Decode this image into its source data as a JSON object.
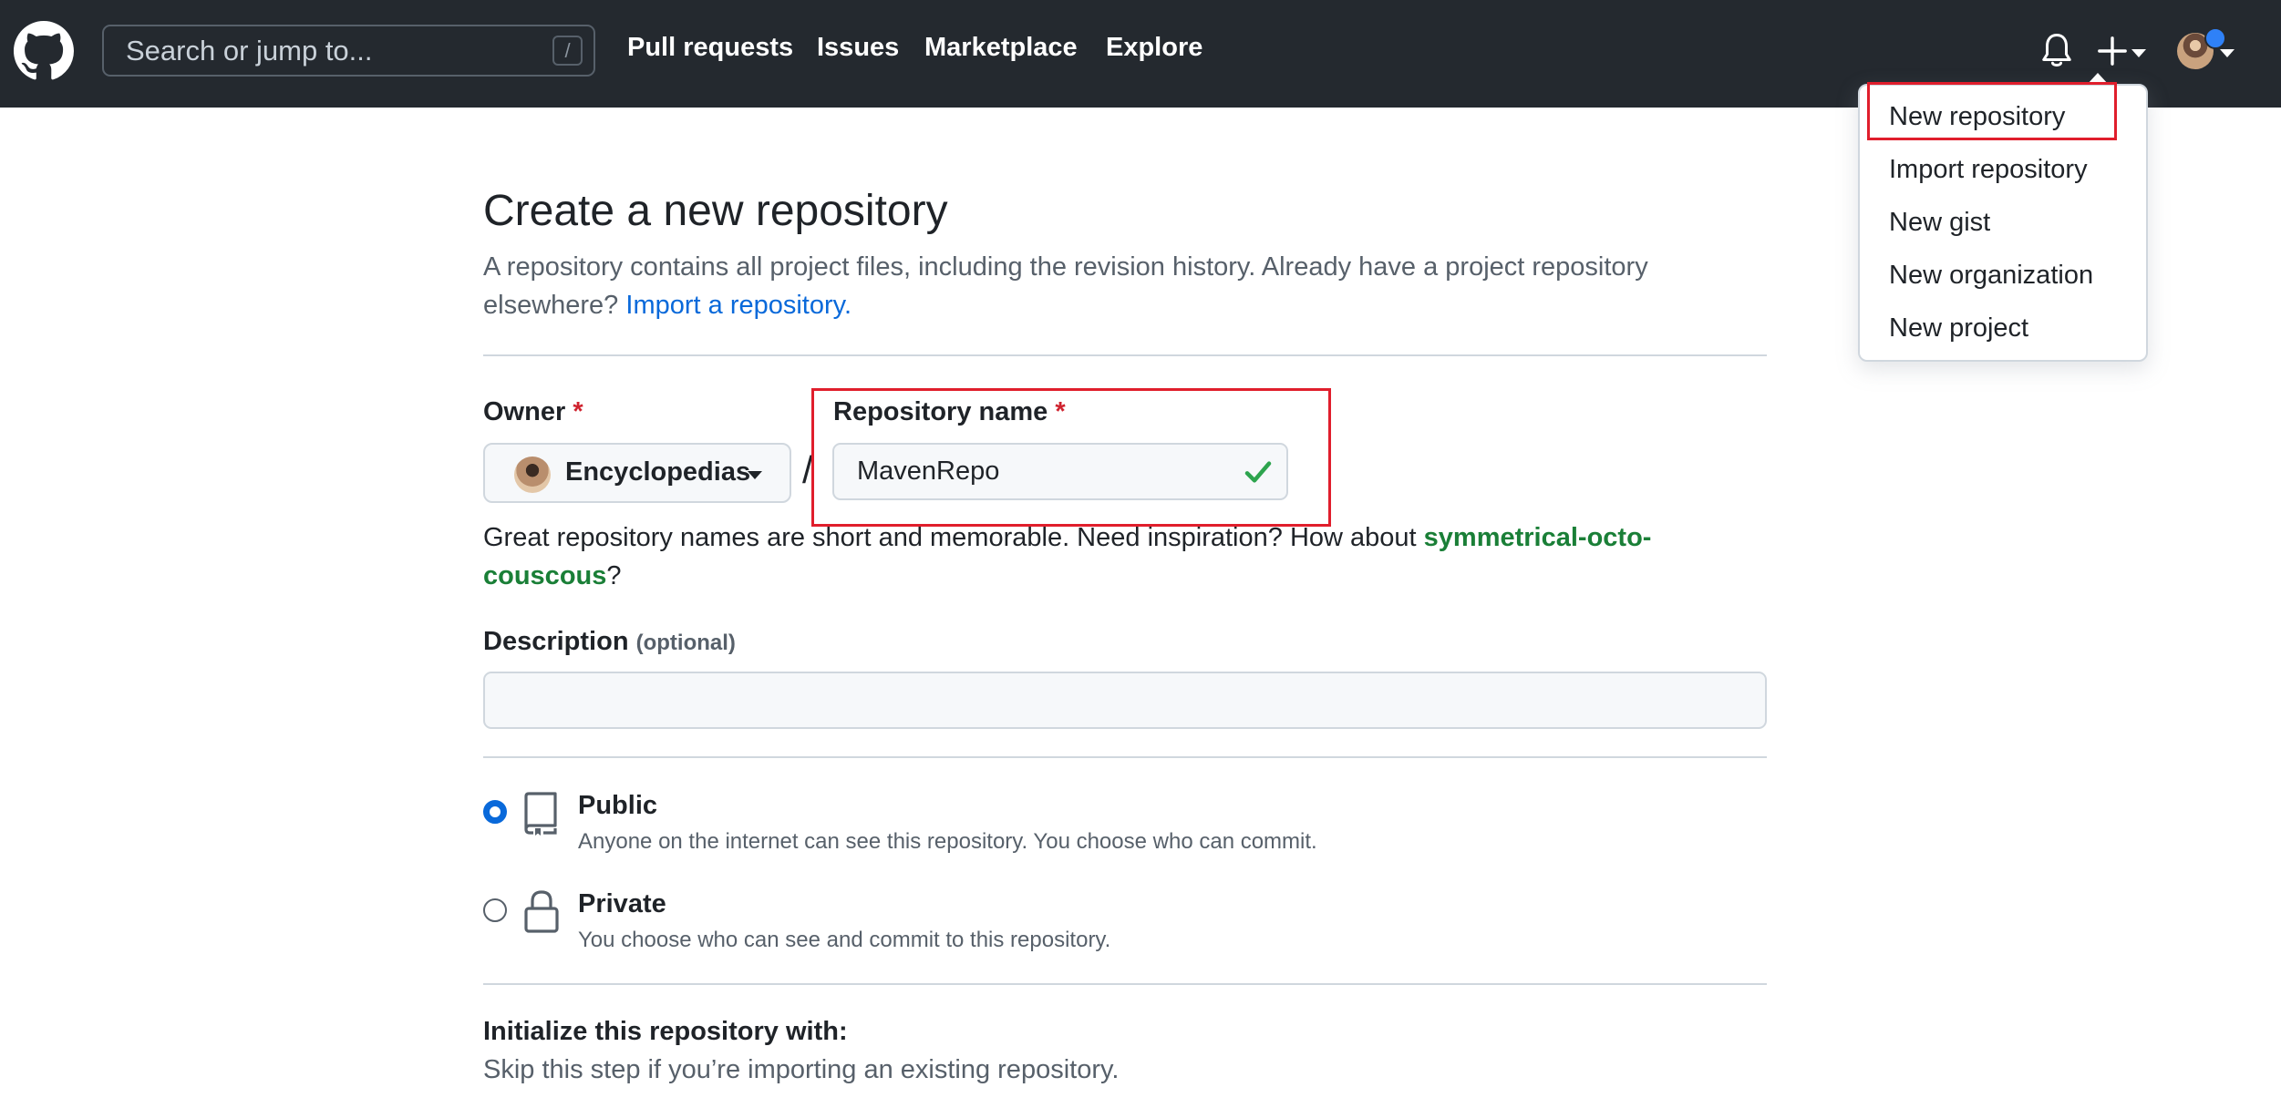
{
  "header": {
    "search_placeholder": "Search or jump to...",
    "search_shortcut": "/",
    "nav": {
      "pull_requests": "Pull requests",
      "issues": "Issues",
      "marketplace": "Marketplace",
      "explore": "Explore"
    },
    "icons": [
      "github-logo-icon",
      "bell-icon",
      "plus-icon",
      "avatar"
    ]
  },
  "create_menu": {
    "items": [
      "New repository",
      "Import repository",
      "New gist",
      "New organization",
      "New project"
    ],
    "highlighted_item": "New repository"
  },
  "page": {
    "title": "Create a new repository",
    "lead_text": "A repository contains all project files, including the revision history. Already have a project repository elsewhere?",
    "import_link": "Import a repository.",
    "owner_label": "Owner",
    "required_mark": "*",
    "owner_value": "Encyclopedias",
    "separator": "/",
    "repo_name_label": "Repository name",
    "repo_name_value": "MavenRepo",
    "hint_text": "Great repository names are short and memorable. Need inspiration? How about",
    "hint_suggestion": "symmetrical-octo-couscous",
    "hint_end": "?",
    "description_label": "Description",
    "description_optional": "(optional)",
    "description_value": "",
    "visibility": {
      "selected": "Public",
      "public_title": "Public",
      "public_desc": "Anyone on the internet can see this repository. You choose who can commit.",
      "private_title": "Private",
      "private_desc": "You choose who can see and commit to this repository."
    },
    "init_title": "Initialize this repository with:",
    "init_desc": "Skip this step if you’re importing an existing repository."
  },
  "colors": {
    "header_bg": "#24292f",
    "link": "#0969da",
    "required": "#cf222e",
    "suggestion": "#1a7f37",
    "annotation_box": "#e01e2c",
    "notification_dot": "#2f81f7"
  }
}
